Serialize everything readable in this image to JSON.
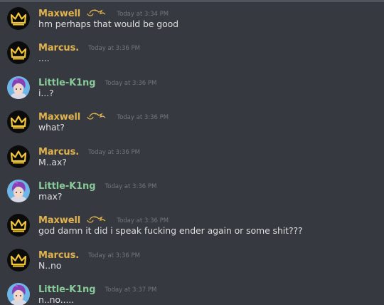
{
  "colors": {
    "background": "#36393f",
    "text": "#dcddde",
    "timestamp": "#72767d",
    "maxwell_name": "#e1b34d",
    "marcus_name": "#e1b34d",
    "littlek1ng_name": "#88c999"
  },
  "messages": [
    {
      "author": "Maxwell",
      "author_decoration": "lamp-icon",
      "avatar": "crown-avatar",
      "timestamp": "Today at 3:34 PM",
      "content": "hm perhaps that would be good"
    },
    {
      "author": "Marcus.",
      "avatar": "crown-avatar",
      "timestamp": "Today at 3:36 PM",
      "content": "...."
    },
    {
      "author": "Little-K1ng",
      "avatar": "anime-boy-avatar",
      "timestamp": "Today at 3:36 PM",
      "content": "i...?"
    },
    {
      "author": "Maxwell",
      "author_decoration": "lamp-icon",
      "avatar": "crown-avatar",
      "timestamp": "Today at 3:36 PM",
      "content": "what?"
    },
    {
      "author": "Marcus.",
      "avatar": "crown-avatar",
      "timestamp": "Today at 3:36 PM",
      "content": "M..ax?"
    },
    {
      "author": "Little-K1ng",
      "avatar": "anime-boy-avatar",
      "timestamp": "Today at 3:36 PM",
      "content": "max?"
    },
    {
      "author": "Maxwell",
      "author_decoration": "lamp-icon",
      "avatar": "crown-avatar",
      "timestamp": "Today at 3:36 PM",
      "content": "god damn it did i speak fucking ender again or some shit???"
    },
    {
      "author": "Marcus.",
      "avatar": "crown-avatar",
      "timestamp": "Today at 3:36 PM",
      "content": "N..no"
    },
    {
      "author": "Little-K1ng",
      "avatar": "anime-boy-avatar",
      "timestamp": "Today at 3:37 PM",
      "content": "n..no....."
    }
  ]
}
